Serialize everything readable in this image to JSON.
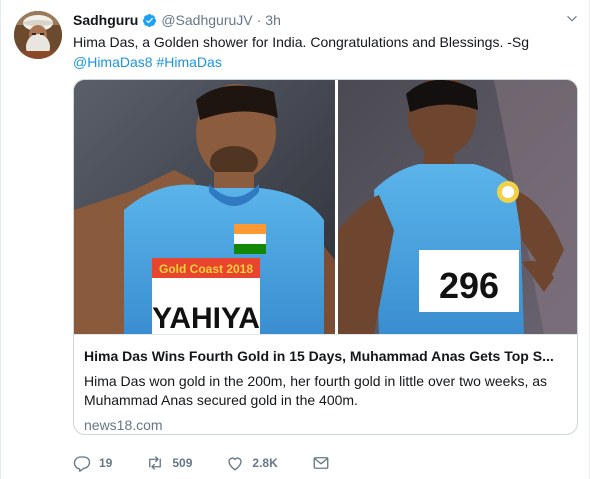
{
  "author": {
    "name": "Sadhguru",
    "handle": "@SadhguruJV",
    "time": "3h"
  },
  "tweet": {
    "text_line1": "Hima Das, a Golden shower for India.  Congratulations and Blessings. -Sg",
    "mention": "@HimaDas8",
    "hashtag": "#HimaDas"
  },
  "card": {
    "title": "Hima Das Wins Fourth Gold in 15 Days, Muhammad Anas Gets Top S...",
    "description": "Hima Das won gold in the 200m, her fourth gold in little over two weeks, as Muhammad Anas secured gold in the 400m.",
    "domain": "news18.com",
    "photo_left_bib_banner": "Gold Coast 2018",
    "photo_left_bib_name": "YAHIYA",
    "photo_right_bib_number": "296"
  },
  "actions": {
    "reply_count": "19",
    "retweet_count": "509",
    "like_count": "2.8K"
  },
  "icons": {
    "verified": "verified-badge-icon",
    "caret": "chevron-down-icon",
    "reply": "reply-icon",
    "retweet": "retweet-icon",
    "like": "heart-icon",
    "dm": "envelope-icon"
  },
  "colors": {
    "link": "#1b95e0",
    "muted": "#657786",
    "text": "#14171a",
    "verified": "#1da1f2"
  }
}
